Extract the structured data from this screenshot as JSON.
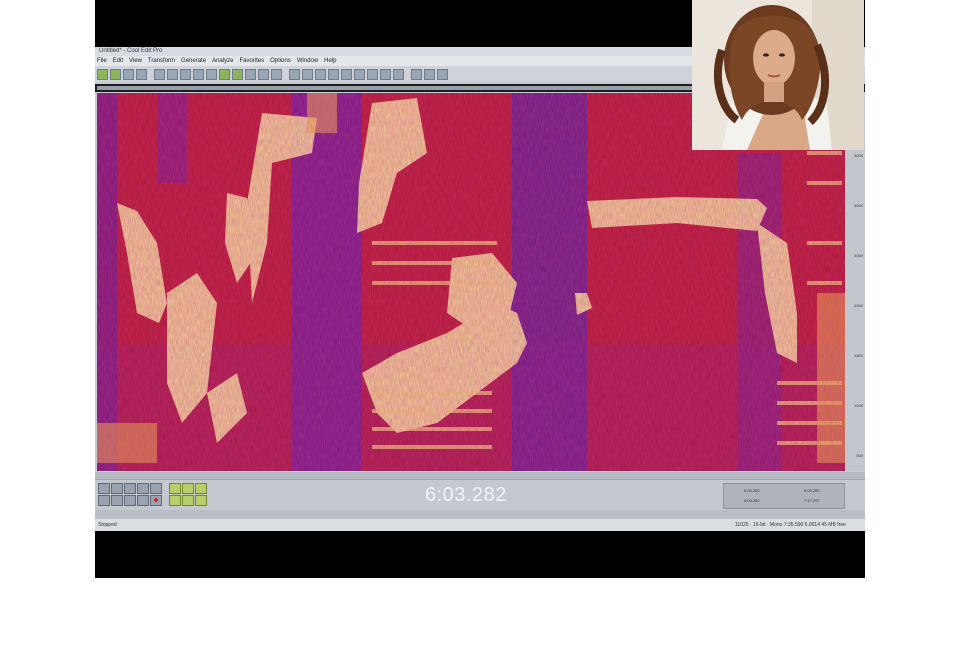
{
  "window": {
    "title": "Untitled* - Cool Edit Pro"
  },
  "menu": [
    "File",
    "Edit",
    "View",
    "Transform",
    "Generate",
    "Analyze",
    "Favorites",
    "Options",
    "Window",
    "Help"
  ],
  "transport": {
    "time_display": "6:03.282"
  },
  "info_panel": {
    "begin_1": "6:03.282",
    "end_1": "6:03.282",
    "begin_2": "6:03.282",
    "end_2": "7:17.297"
  },
  "status": {
    "left": "Stopped",
    "right": "11025 · 16-bit · Mono   7:35.590   6.0014 45 MB free"
  },
  "overlay_photo": {
    "subject": "portrait-photo"
  }
}
